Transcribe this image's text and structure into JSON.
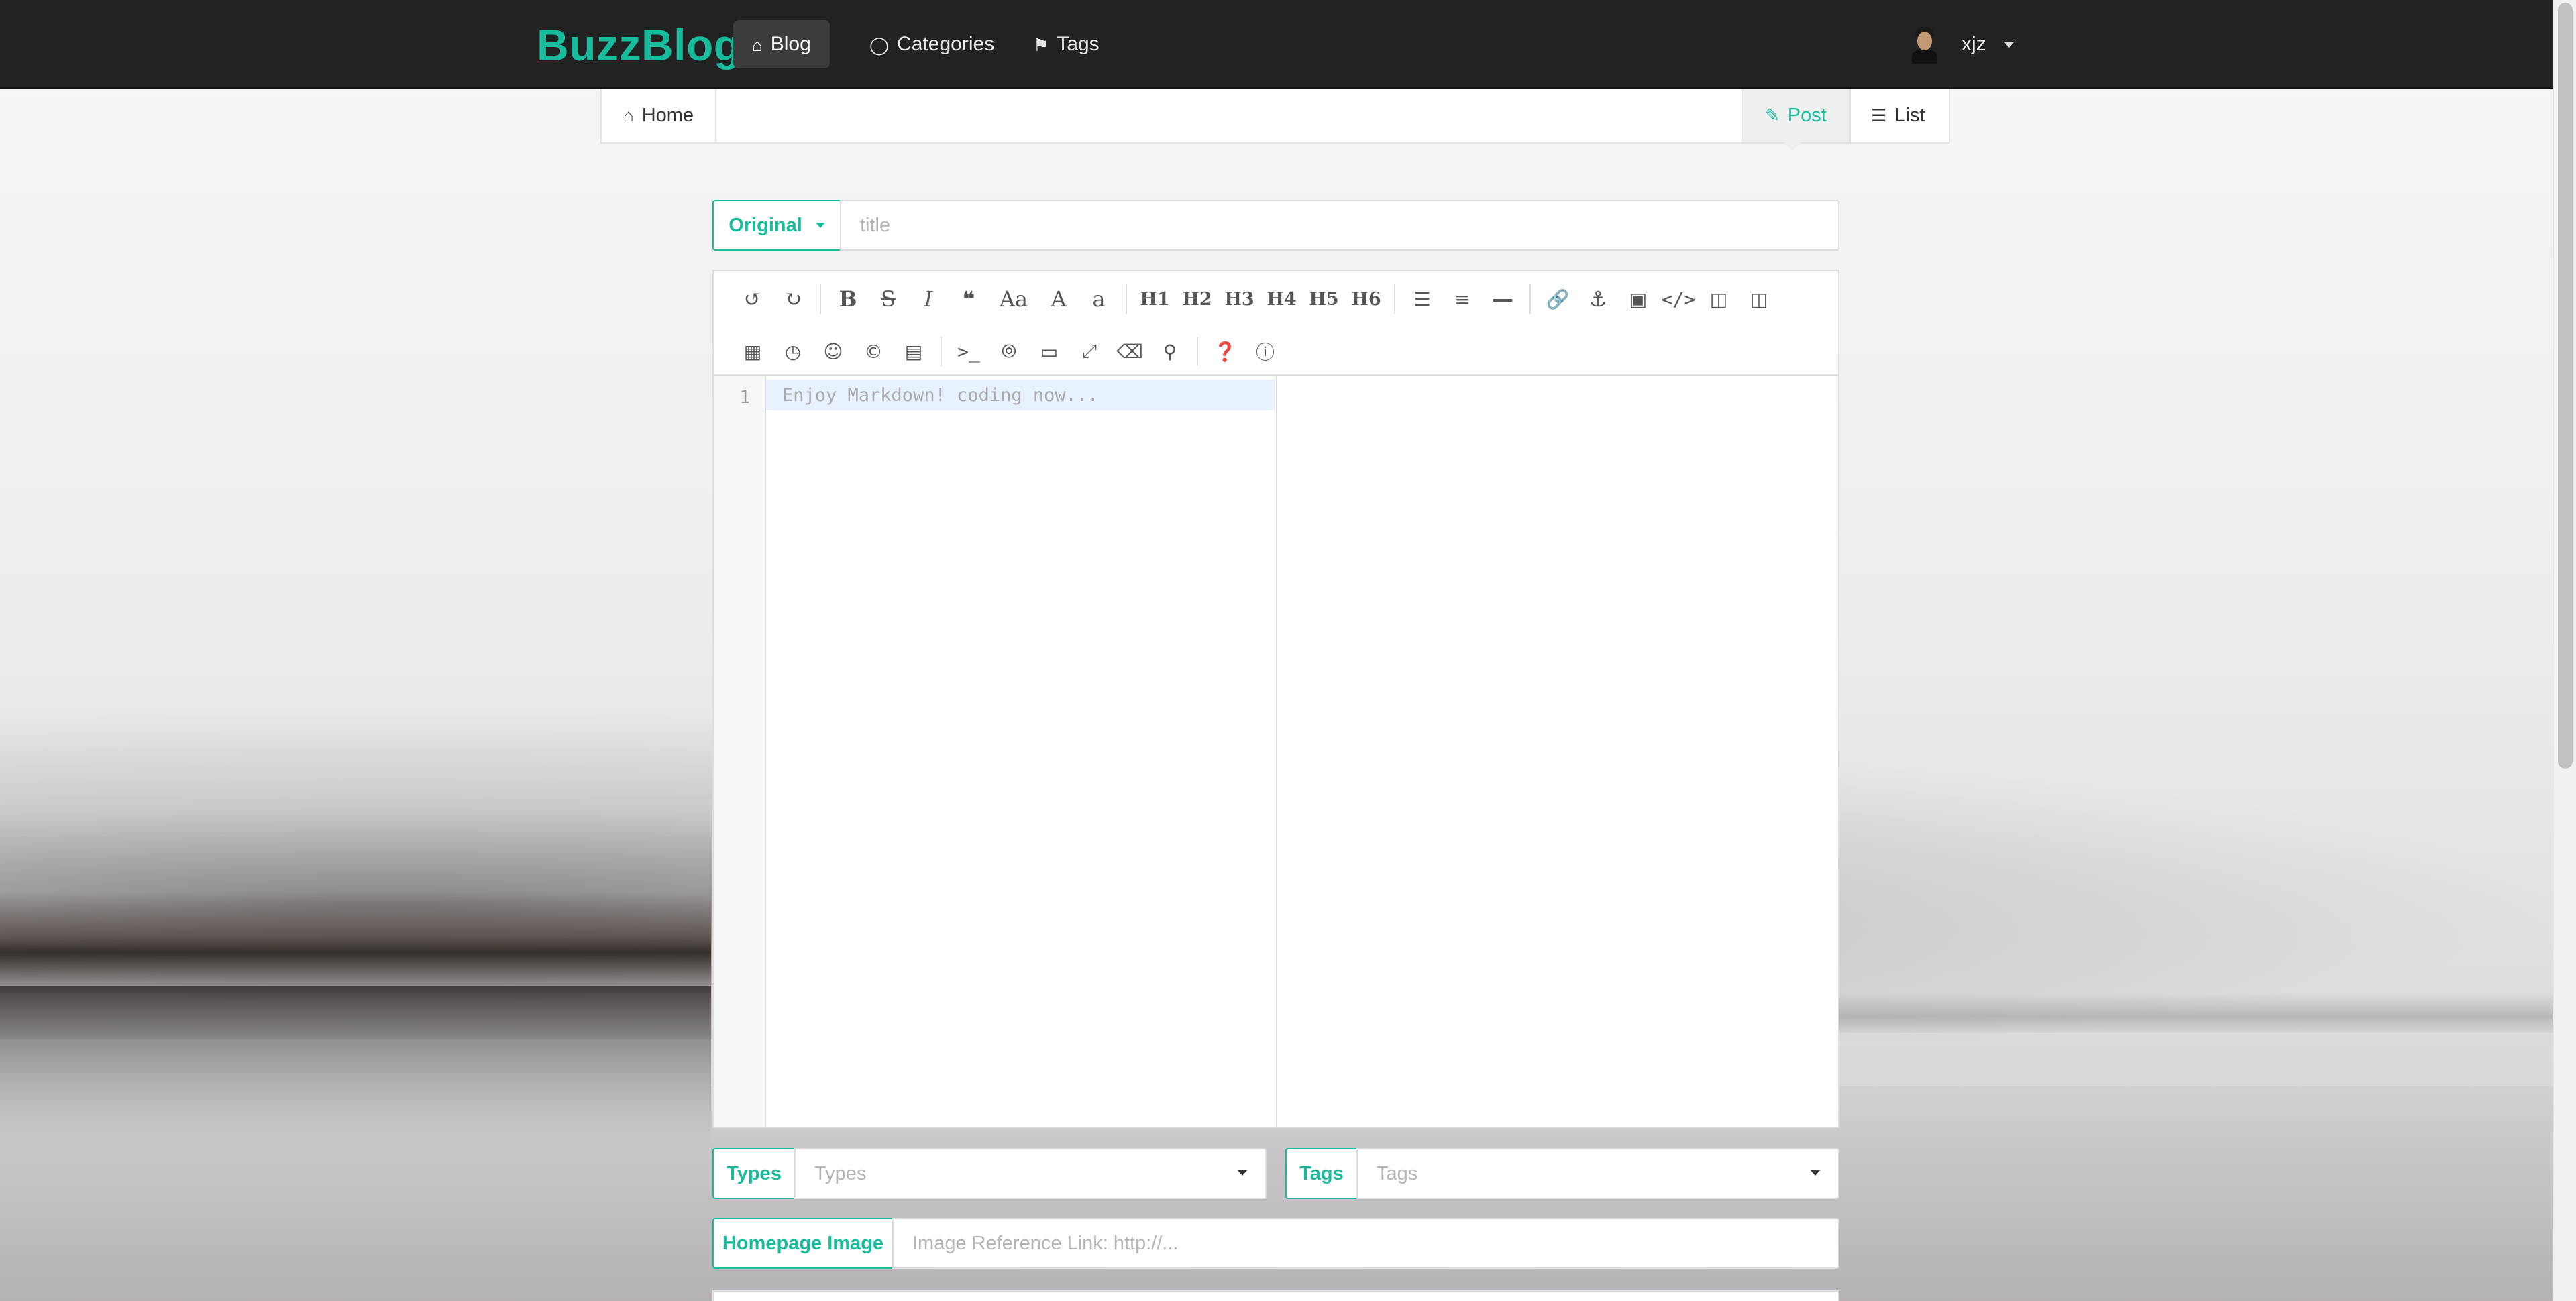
{
  "navbar": {
    "brand": "BuzzBlog",
    "items": [
      {
        "label": "Blog",
        "icon": "home-icon",
        "active": true
      },
      {
        "label": "Categories",
        "icon": "lightbulb-icon",
        "active": false
      },
      {
        "label": "Tags",
        "icon": "tags-icon",
        "active": false
      }
    ],
    "user": {
      "name": "xjz",
      "avatar_icon": "user-avatar"
    }
  },
  "subnav": {
    "home": "Home",
    "post": "Post",
    "list": "List"
  },
  "form": {
    "type_button": "Original",
    "title_placeholder": "title",
    "types_label": "Types",
    "types_placeholder": "Types",
    "tags_label": "Tags",
    "tags_placeholder": "Tags",
    "homepage_image_label": "Homepage Image",
    "homepage_image_placeholder": "Image Reference Link: http://..."
  },
  "editor": {
    "line_number": "1",
    "placeholder": "Enjoy Markdown! coding now...",
    "toolbar_row1": [
      "undo-icon",
      "redo-icon",
      "|",
      "bold-icon",
      "strikethrough-icon",
      "italic-icon",
      "quote-icon",
      "uppercase-icon",
      "ucwords-icon",
      "lowercase-icon",
      "|",
      "H1",
      "H2",
      "H3",
      "H4",
      "H5",
      "H6",
      "|",
      "list-ul-icon",
      "list-ol-icon",
      "hr-icon",
      "|",
      "link-icon",
      "anchor-icon",
      "image-icon",
      "code-icon",
      "preformatted-code-icon",
      "code-block-icon"
    ],
    "toolbar_row2": [
      "table-icon",
      "datetime-icon",
      "emoji-icon",
      "html-entities-icon",
      "pagebreak-icon",
      "|",
      "goto-line-icon",
      "watch-icon",
      "preview-icon",
      "fullscreen-icon",
      "clear-icon",
      "search-icon",
      "|",
      "help-icon",
      "info-icon"
    ]
  },
  "colors": {
    "accent": "#18bc9c",
    "navbar": "#222222"
  }
}
